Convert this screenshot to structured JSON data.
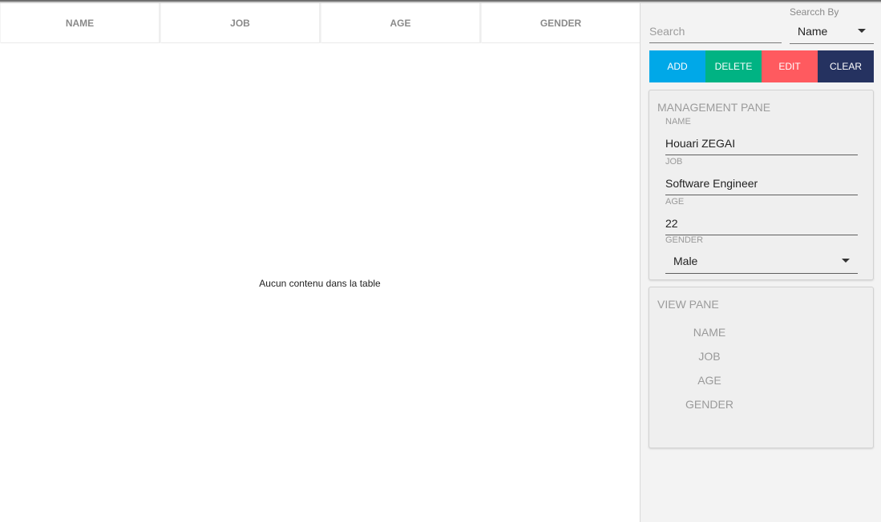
{
  "table": {
    "columns": [
      "NAME",
      "JOB",
      "AGE",
      "GENDER"
    ],
    "empty_message": "Aucun contenu dans la table"
  },
  "search": {
    "placeholder": "Search",
    "value": "",
    "by_label": "Searcch By",
    "by_value": "Name"
  },
  "actions": {
    "add": "ADD",
    "delete": "DELETE",
    "edit": "EDIT",
    "clear": "CLEAR"
  },
  "colors": {
    "add": "#00a8e8",
    "delete": "#00b383",
    "edit": "#ff5a5f",
    "clear": "#253260"
  },
  "management": {
    "title": "MANAGEMENT PANE",
    "name_label": "NAME",
    "name_value": "Houari ZEGAI",
    "job_label": "JOB",
    "job_value": "Software Engineer",
    "age_label": "AGE",
    "age_value": "22",
    "gender_label": "GENDER",
    "gender_value": "Male"
  },
  "view": {
    "title": "VIEW PANE",
    "name_label": "NAME",
    "job_label": "JOB",
    "age_label": "AGE",
    "gender_label": "GENDER"
  },
  "icons": {
    "dropdown": "caret-down-icon"
  }
}
